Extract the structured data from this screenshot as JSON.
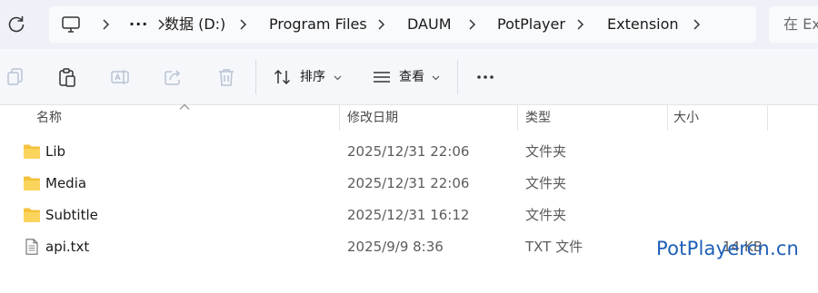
{
  "addressbar": {
    "refresh_icon": "refresh-icon",
    "breadcrumb": [
      "数据 (D:)",
      "Program Files",
      "DAUM",
      "PotPlayer",
      "Extension"
    ],
    "search_placeholder": "在 Ex"
  },
  "toolbar": {
    "sort_label": "排序",
    "view_label": "查看",
    "more_icon": "more-icon"
  },
  "columns": {
    "name": "名称",
    "modified": "修改日期",
    "type": "类型",
    "size": "大小"
  },
  "files": [
    {
      "name": "Lib",
      "modified": "2025/12/31 22:06",
      "type": "文件夹",
      "size": "",
      "icon": "folder-icon"
    },
    {
      "name": "Media",
      "modified": "2025/12/31 22:06",
      "type": "文件夹",
      "size": "",
      "icon": "folder-icon"
    },
    {
      "name": "Subtitle",
      "modified": "2025/12/31 16:12",
      "type": "文件夹",
      "size": "",
      "icon": "folder-icon"
    },
    {
      "name": "api.txt",
      "modified": "2025/9/9 8:36",
      "type": "TXT 文件",
      "size": "14 KB",
      "icon": "text-file-icon"
    }
  ],
  "watermark": "PotPlayercn.cn",
  "colors": {
    "addressbar_bg": "#eef2f8",
    "toolbar_bg": "#f5f7fb",
    "folder": "#f3c23c",
    "watermark": "#1f5fb8"
  }
}
